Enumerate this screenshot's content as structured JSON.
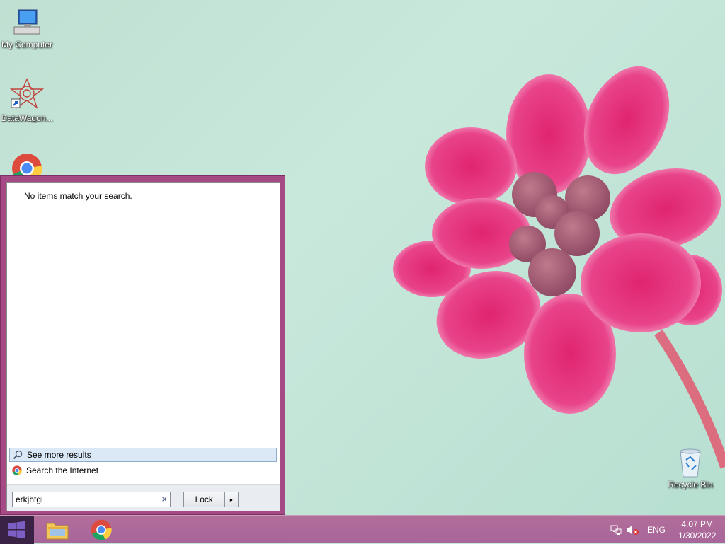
{
  "desktop": {
    "icons": [
      {
        "label": "My Computer",
        "icon": "computer-icon"
      },
      {
        "label": "DataWagon...",
        "icon": "datawagon-icon"
      },
      {
        "label": "",
        "icon": "chrome-icon"
      },
      {
        "label": "Recycle Bin",
        "icon": "recycle-bin-icon"
      }
    ]
  },
  "start_menu": {
    "message": "No items match your search.",
    "results": [
      {
        "label": "See more results",
        "icon": "search-icon",
        "selected": true
      },
      {
        "label": "Search the Internet",
        "icon": "chrome-icon",
        "selected": false
      }
    ],
    "search": {
      "value": "erkjhtgi",
      "clear_glyph": "×"
    },
    "lock_button": {
      "label": "Lock",
      "arrow": "▸"
    }
  },
  "taskbar": {
    "start_icon": "windows-logo-icon",
    "items": [
      {
        "name": "file-explorer",
        "icon": "folder-icon"
      },
      {
        "name": "chrome",
        "icon": "chrome-icon"
      }
    ],
    "tray": {
      "network_icon": "network-icon",
      "volume_icon": "volume-muted-icon",
      "language": "ENG",
      "time": "4:07 PM",
      "date": "1/30/2022"
    }
  },
  "colors": {
    "accent": "#a64a86",
    "taskbar": "#b26e9a",
    "start_button": "#3a2245"
  }
}
